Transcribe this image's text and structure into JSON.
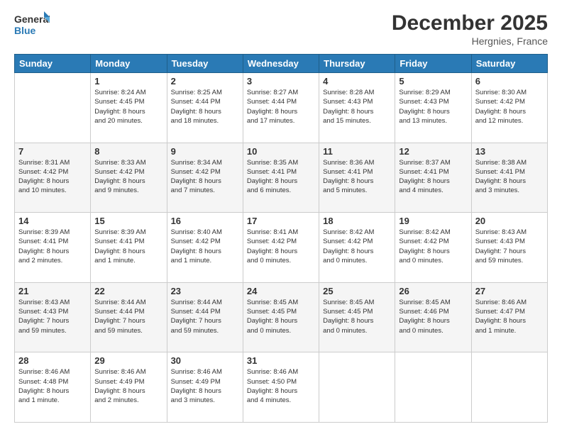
{
  "logo": {
    "line1": "General",
    "line2": "Blue"
  },
  "title": "December 2025",
  "location": "Hergnies, France",
  "headers": [
    "Sunday",
    "Monday",
    "Tuesday",
    "Wednesday",
    "Thursday",
    "Friday",
    "Saturday"
  ],
  "weeks": [
    [
      {
        "day": "",
        "info": ""
      },
      {
        "day": "1",
        "info": "Sunrise: 8:24 AM\nSunset: 4:45 PM\nDaylight: 8 hours\nand 20 minutes."
      },
      {
        "day": "2",
        "info": "Sunrise: 8:25 AM\nSunset: 4:44 PM\nDaylight: 8 hours\nand 18 minutes."
      },
      {
        "day": "3",
        "info": "Sunrise: 8:27 AM\nSunset: 4:44 PM\nDaylight: 8 hours\nand 17 minutes."
      },
      {
        "day": "4",
        "info": "Sunrise: 8:28 AM\nSunset: 4:43 PM\nDaylight: 8 hours\nand 15 minutes."
      },
      {
        "day": "5",
        "info": "Sunrise: 8:29 AM\nSunset: 4:43 PM\nDaylight: 8 hours\nand 13 minutes."
      },
      {
        "day": "6",
        "info": "Sunrise: 8:30 AM\nSunset: 4:42 PM\nDaylight: 8 hours\nand 12 minutes."
      }
    ],
    [
      {
        "day": "7",
        "info": "Sunrise: 8:31 AM\nSunset: 4:42 PM\nDaylight: 8 hours\nand 10 minutes."
      },
      {
        "day": "8",
        "info": "Sunrise: 8:33 AM\nSunset: 4:42 PM\nDaylight: 8 hours\nand 9 minutes."
      },
      {
        "day": "9",
        "info": "Sunrise: 8:34 AM\nSunset: 4:42 PM\nDaylight: 8 hours\nand 7 minutes."
      },
      {
        "day": "10",
        "info": "Sunrise: 8:35 AM\nSunset: 4:41 PM\nDaylight: 8 hours\nand 6 minutes."
      },
      {
        "day": "11",
        "info": "Sunrise: 8:36 AM\nSunset: 4:41 PM\nDaylight: 8 hours\nand 5 minutes."
      },
      {
        "day": "12",
        "info": "Sunrise: 8:37 AM\nSunset: 4:41 PM\nDaylight: 8 hours\nand 4 minutes."
      },
      {
        "day": "13",
        "info": "Sunrise: 8:38 AM\nSunset: 4:41 PM\nDaylight: 8 hours\nand 3 minutes."
      }
    ],
    [
      {
        "day": "14",
        "info": "Sunrise: 8:39 AM\nSunset: 4:41 PM\nDaylight: 8 hours\nand 2 minutes."
      },
      {
        "day": "15",
        "info": "Sunrise: 8:39 AM\nSunset: 4:41 PM\nDaylight: 8 hours\nand 1 minute."
      },
      {
        "day": "16",
        "info": "Sunrise: 8:40 AM\nSunset: 4:42 PM\nDaylight: 8 hours\nand 1 minute."
      },
      {
        "day": "17",
        "info": "Sunrise: 8:41 AM\nSunset: 4:42 PM\nDaylight: 8 hours\nand 0 minutes."
      },
      {
        "day": "18",
        "info": "Sunrise: 8:42 AM\nSunset: 4:42 PM\nDaylight: 8 hours\nand 0 minutes."
      },
      {
        "day": "19",
        "info": "Sunrise: 8:42 AM\nSunset: 4:42 PM\nDaylight: 8 hours\nand 0 minutes."
      },
      {
        "day": "20",
        "info": "Sunrise: 8:43 AM\nSunset: 4:43 PM\nDaylight: 7 hours\nand 59 minutes."
      }
    ],
    [
      {
        "day": "21",
        "info": "Sunrise: 8:43 AM\nSunset: 4:43 PM\nDaylight: 7 hours\nand 59 minutes."
      },
      {
        "day": "22",
        "info": "Sunrise: 8:44 AM\nSunset: 4:44 PM\nDaylight: 7 hours\nand 59 minutes."
      },
      {
        "day": "23",
        "info": "Sunrise: 8:44 AM\nSunset: 4:44 PM\nDaylight: 7 hours\nand 59 minutes."
      },
      {
        "day": "24",
        "info": "Sunrise: 8:45 AM\nSunset: 4:45 PM\nDaylight: 8 hours\nand 0 minutes."
      },
      {
        "day": "25",
        "info": "Sunrise: 8:45 AM\nSunset: 4:45 PM\nDaylight: 8 hours\nand 0 minutes."
      },
      {
        "day": "26",
        "info": "Sunrise: 8:45 AM\nSunset: 4:46 PM\nDaylight: 8 hours\nand 0 minutes."
      },
      {
        "day": "27",
        "info": "Sunrise: 8:46 AM\nSunset: 4:47 PM\nDaylight: 8 hours\nand 1 minute."
      }
    ],
    [
      {
        "day": "28",
        "info": "Sunrise: 8:46 AM\nSunset: 4:48 PM\nDaylight: 8 hours\nand 1 minute."
      },
      {
        "day": "29",
        "info": "Sunrise: 8:46 AM\nSunset: 4:49 PM\nDaylight: 8 hours\nand 2 minutes."
      },
      {
        "day": "30",
        "info": "Sunrise: 8:46 AM\nSunset: 4:49 PM\nDaylight: 8 hours\nand 3 minutes."
      },
      {
        "day": "31",
        "info": "Sunrise: 8:46 AM\nSunset: 4:50 PM\nDaylight: 8 hours\nand 4 minutes."
      },
      {
        "day": "",
        "info": ""
      },
      {
        "day": "",
        "info": ""
      },
      {
        "day": "",
        "info": ""
      }
    ]
  ]
}
